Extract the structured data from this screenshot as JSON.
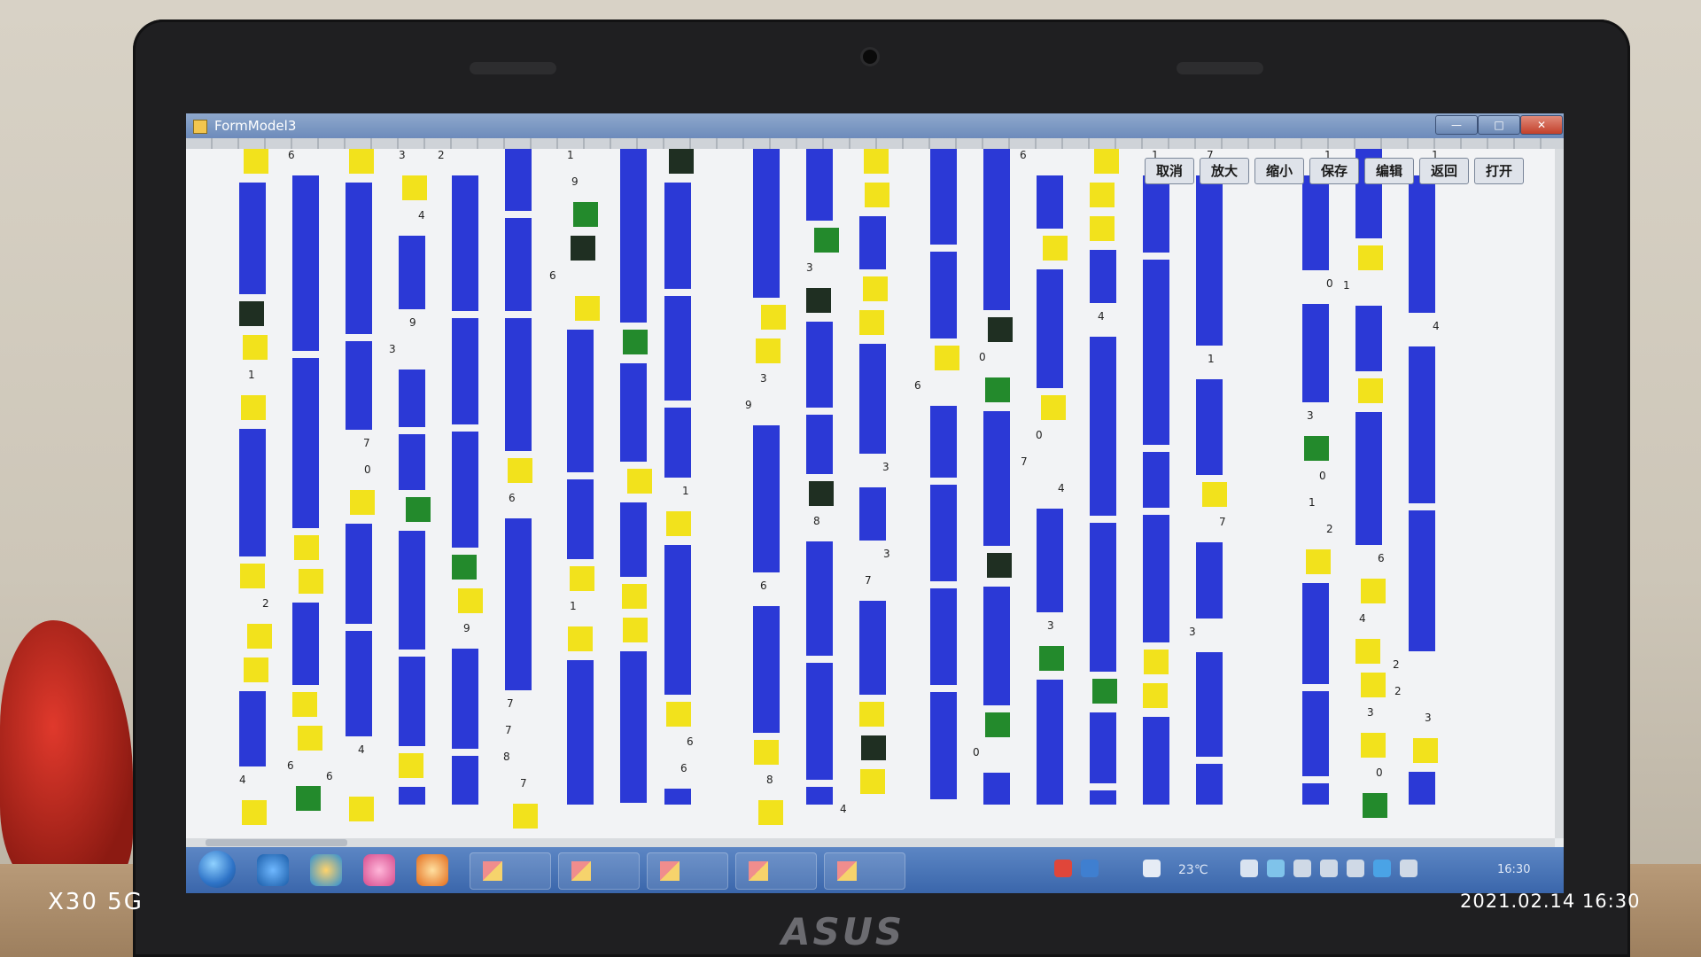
{
  "window": {
    "title": "FormModel3",
    "controls": {
      "minimize": "—",
      "maximize": "□",
      "close": "✕"
    }
  },
  "toolbar": {
    "buttons": [
      {
        "id": "cancel",
        "label": "取消"
      },
      {
        "id": "zoom-in",
        "label": "放大"
      },
      {
        "id": "zoom-out",
        "label": "缩小"
      },
      {
        "id": "save",
        "label": "保存"
      },
      {
        "id": "edit",
        "label": "编辑"
      },
      {
        "id": "back",
        "label": "返回"
      },
      {
        "id": "open",
        "label": "打开"
      }
    ]
  },
  "grid_colors": {
    "blue": "#2b39d6",
    "yellow": "#f2e21c",
    "dark": "#1f2f22",
    "green": "#238a2c",
    "background": "#f2f3f5"
  },
  "taskbar": {
    "tray_temperature": "23℃",
    "tray_clock": "16:30"
  },
  "camera_overlay": {
    "device": "X30 5G",
    "timestamp": "2021.02.14 16:30"
  }
}
